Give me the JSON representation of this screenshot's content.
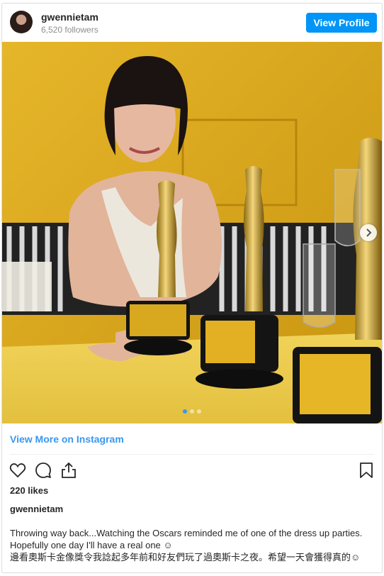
{
  "header": {
    "username": "gwennietam",
    "followers": "6,520 followers",
    "view_profile_label": "View Profile"
  },
  "post": {
    "view_more_label": "View More on Instagram",
    "likes": "220 likes",
    "caption_username": "gwennietam",
    "caption_text": "Throwing way back...Watching the Oscars reminded me of one of the dress up parties. Hopefully one day I'll have a real one ☺\n邊看奧斯卡金像獎令我諗起多年前和好友們玩了過奧斯卡之夜。希望一天會獲得真的☺",
    "carousel_count": 3,
    "carousel_active": 0
  },
  "icons": {
    "like": "heart-icon",
    "comment": "comment-icon",
    "share": "share-icon",
    "save": "bookmark-icon",
    "next": "chevron-right-icon"
  },
  "colors": {
    "accent": "#0095f6",
    "link": "#3897f0",
    "muted": "#8e8e8e"
  }
}
